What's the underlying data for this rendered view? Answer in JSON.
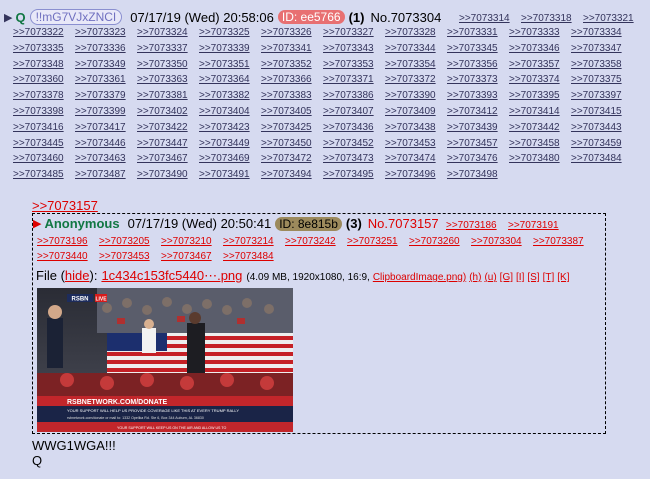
{
  "op": {
    "name": "Q",
    "tripcode": "!!mG7VJxZNCI",
    "date": "07/17/19 (Wed) 20:58:06",
    "id_label": "ID: ee5766",
    "count": "(1)",
    "post_no": "No.7073304",
    "backlinks": [
      [
        ">>7073314",
        ">>7073318",
        ">>7073321"
      ],
      [
        ">>7073322",
        ">>7073323",
        ">>7073324",
        ">>7073325",
        ">>7073326",
        ">>7073327",
        ">>7073328",
        ">>7073331",
        ">>7073333",
        ">>7073334"
      ],
      [
        ">>7073335",
        ">>7073336",
        ">>7073337",
        ">>7073339",
        ">>7073341",
        ">>7073343",
        ">>7073344",
        ">>7073345",
        ">>7073346",
        ">>7073347"
      ],
      [
        ">>7073348",
        ">>7073349",
        ">>7073350",
        ">>7073351",
        ">>7073352",
        ">>7073353",
        ">>7073354",
        ">>7073356",
        ">>7073357",
        ">>7073358"
      ],
      [
        ">>7073360",
        ">>7073361",
        ">>7073363",
        ">>7073364",
        ">>7073366",
        ">>7073371",
        ">>7073372",
        ">>7073373",
        ">>7073374",
        ">>7073375"
      ],
      [
        ">>7073378",
        ">>7073379",
        ">>7073381",
        ">>7073382",
        ">>7073383",
        ">>7073386",
        ">>7073390",
        ">>7073393",
        ">>7073395",
        ">>7073397"
      ],
      [
        ">>7073398",
        ">>7073399",
        ">>7073402",
        ">>7073404",
        ">>7073405",
        ">>7073407",
        ">>7073409",
        ">>7073412",
        ">>7073414",
        ">>7073415"
      ],
      [
        ">>7073416",
        ">>7073417",
        ">>7073422",
        ">>7073423",
        ">>7073425",
        ">>7073436",
        ">>7073438",
        ">>7073439",
        ">>7073442",
        ">>7073443"
      ],
      [
        ">>7073445",
        ">>7073446",
        ">>7073447",
        ">>7073449",
        ">>7073450",
        ">>7073452",
        ">>7073453",
        ">>7073457",
        ">>7073458",
        ">>7073459"
      ],
      [
        ">>7073460",
        ">>7073463",
        ">>7073467",
        ">>7073469",
        ">>7073472",
        ">>7073473",
        ">>7073474",
        ">>7073476",
        ">>7073480",
        ">>7073484"
      ],
      [
        ">>7073485",
        ">>7073487",
        ">>7073490",
        ">>7073491",
        ">>7073494",
        ">>7073495",
        ">>7073496",
        ">>7073498"
      ]
    ],
    "message": [
      "WWG1WGA!!!",
      "Q"
    ]
  },
  "quote_link": ">>7073157",
  "reply": {
    "name": "Anonymous",
    "date": "07/17/19 (Wed) 20:50:41",
    "id_label": "ID: 8e815b",
    "count": "(3)",
    "post_no": "No.7073157",
    "backlinks": [
      [
        ">>7073186",
        ">>7073191"
      ],
      [
        ">>7073196",
        ">>7073205",
        ">>7073210",
        ">>7073214",
        ">>7073242",
        ">>7073251",
        ">>7073260",
        ">>7073304",
        ">>7073387"
      ],
      [
        ">>7073440",
        ">>7073453",
        ">>7073467",
        ">>7073484"
      ]
    ],
    "file_label": "File",
    "hide_label": "hide",
    "file_name": "1c434c153fc5440⋯.png",
    "file_meta": "(4.09 MB, 1920x1080, 16:9,",
    "file_orig": "ClipboardImage.png)",
    "file_links": [
      "(h)",
      "(u)",
      "[G]",
      "[I]",
      "[S]",
      "[T]",
      "[K]"
    ],
    "image": {
      "logo": "RSBN",
      "live": "LIVE",
      "banner": "RSBNETWORK.COM/DONATE",
      "ticker1": "YOUR SUPPORT WILL HELP US PROVIDE COVERAGE LIKE THIS AT EVERY TRUMP RALLY",
      "ticker2": "rsbnetwork.com/donate or mail to: 1332 Opelika Rd. Ste 6, Box 344 Auburn, AL 36830",
      "ticker3": "YOUR SUPPORT WILL KEEP US ON THE AIR AND ALLOW US TO"
    }
  },
  "colors": {
    "bg": "#d6daf0",
    "link": "#34345c",
    "red": "#dd0000",
    "green": "#117743"
  }
}
